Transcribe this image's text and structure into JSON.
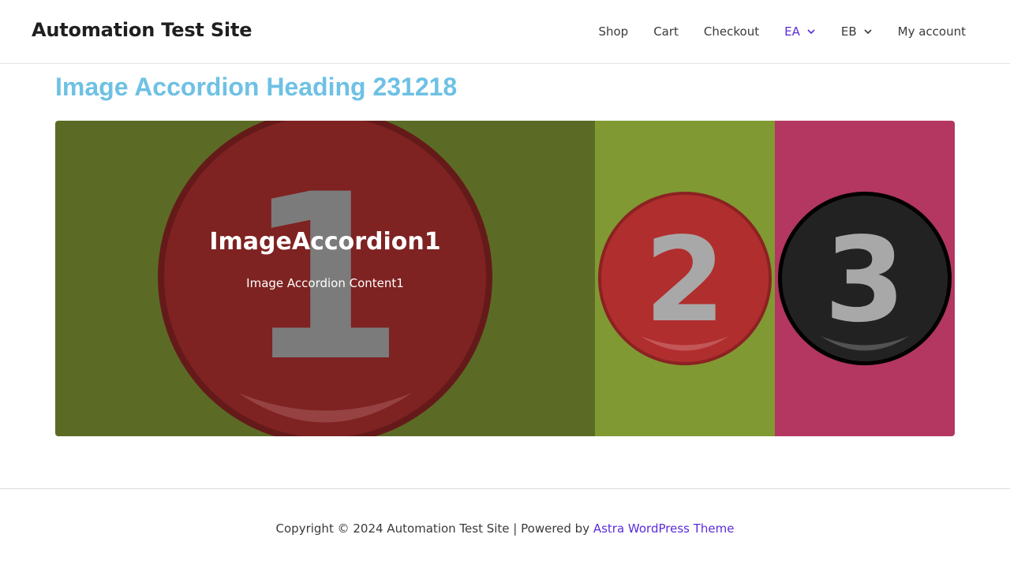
{
  "header": {
    "site_title": "Automation Test Site",
    "nav": [
      {
        "label": "Shop",
        "active": false,
        "has_dropdown": false
      },
      {
        "label": "Cart",
        "active": false,
        "has_dropdown": false
      },
      {
        "label": "Checkout",
        "active": false,
        "has_dropdown": false
      },
      {
        "label": "EA",
        "active": true,
        "has_dropdown": true
      },
      {
        "label": "EB",
        "active": false,
        "has_dropdown": true
      },
      {
        "label": "My account",
        "active": false,
        "has_dropdown": false
      }
    ]
  },
  "main": {
    "heading": "Image Accordion Heading 231218",
    "accordion": {
      "panels": [
        {
          "number": "1",
          "title": "ImageAccordion1",
          "content": "Image Accordion Content1",
          "expanded": true,
          "background": "#5b6b25",
          "badge_color": "#7f2222",
          "badge_ring": "#651a1a"
        },
        {
          "number": "2",
          "expanded": false,
          "background": "#809933",
          "badge_color": "#b12e2e",
          "badge_ring": "#8b2222"
        },
        {
          "number": "3",
          "expanded": false,
          "background": "#b33760",
          "badge_color": "#222222",
          "badge_ring": "#000000"
        }
      ]
    }
  },
  "footer": {
    "copyright": "Copyright © 2024 Automation Test Site | Powered by ",
    "link": "Astra WordPress Theme"
  },
  "colors": {
    "heading": "#6ec1e4",
    "accent": "#5b2bd9",
    "text": "#3a3a3a"
  }
}
